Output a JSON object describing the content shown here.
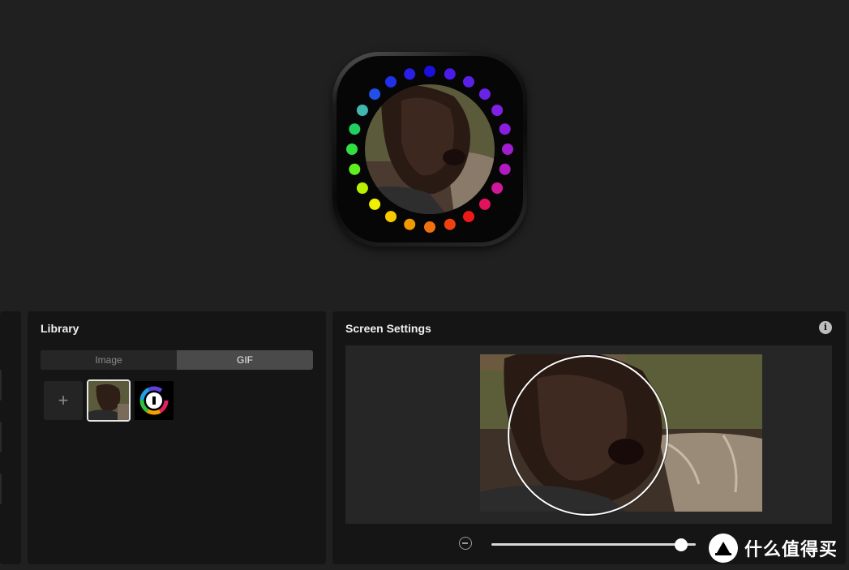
{
  "library": {
    "title": "Library",
    "tabs": {
      "image_label": "Image",
      "gif_label": "GIF",
      "active": "GIF"
    },
    "add_label": "+",
    "items": [
      {
        "name": "gif-thumbnail-crying-man",
        "selected": true
      },
      {
        "name": "brand-logo-thumbnail",
        "selected": false
      }
    ]
  },
  "screen_settings": {
    "title": "Screen Settings",
    "info_glyph": "i",
    "zoom": {
      "level": 0.93
    }
  },
  "led_ring_colors": [
    "#1a0fe0",
    "#4a1cea",
    "#5a20e6",
    "#6a22e4",
    "#8020e4",
    "#8a1ee0",
    "#a01ed0",
    "#b01ac0",
    "#d0189a",
    "#e0145a",
    "#ee1818",
    "#f04010",
    "#f07010",
    "#f09a00",
    "#f8c800",
    "#f0f000",
    "#b8f000",
    "#60f020",
    "#30e040",
    "#20d060",
    "#40b8b0",
    "#2050e8",
    "#2030e8",
    "#2a1ee8"
  ],
  "watermark": {
    "text": "什么值得买"
  }
}
